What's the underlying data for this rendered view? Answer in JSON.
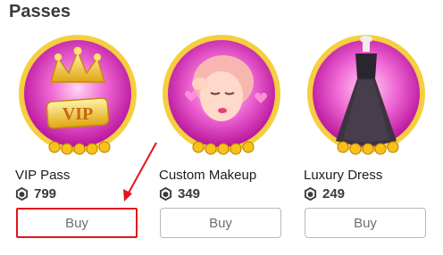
{
  "section": {
    "title": "Passes"
  },
  "passes": [
    {
      "name": "VIP Pass",
      "price": "799",
      "buy_label": "Buy",
      "badge_text": "VIP"
    },
    {
      "name": "Custom Makeup",
      "price": "349",
      "buy_label": "Buy"
    },
    {
      "name": "Luxury Dress",
      "price": "249",
      "buy_label": "Buy"
    }
  ],
  "colors": {
    "highlight": "#e0161a",
    "thumb_ring": "#f2c230",
    "thumb_bg": "#e85fc8"
  },
  "icons": {
    "currency": "robux-icon"
  }
}
